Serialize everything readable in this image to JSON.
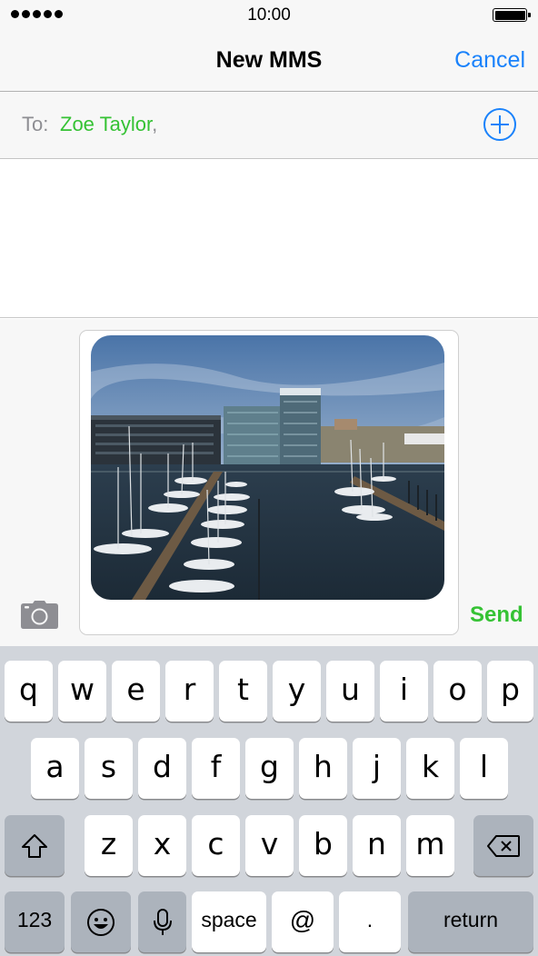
{
  "status_bar": {
    "time": "10:00",
    "signal_dots": 5,
    "battery_level": 1.0
  },
  "nav": {
    "title": "New MMS",
    "cancel_label": "Cancel"
  },
  "to_field": {
    "label": "To:",
    "recipient": "Zoe Taylor",
    "separator": ",",
    "add_icon": "plus-circle-icon"
  },
  "compose": {
    "attachment": "photo of a marina with sailboats and modern office buildings",
    "send_label": "Send",
    "camera_icon": "camera-icon"
  },
  "keyboard": {
    "row1": [
      "q",
      "w",
      "e",
      "r",
      "t",
      "y",
      "u",
      "i",
      "o",
      "p"
    ],
    "row2": [
      "a",
      "s",
      "d",
      "f",
      "g",
      "h",
      "j",
      "k",
      "l"
    ],
    "row3": [
      "z",
      "x",
      "c",
      "v",
      "b",
      "n",
      "m"
    ],
    "numbers_label": "123",
    "space_label": "space",
    "at_label": "@",
    "dot_label": ".",
    "return_label": "return",
    "shift_icon": "shift-arrow-icon",
    "delete_icon": "backspace-icon",
    "emoji_icon": "emoji-icon",
    "mic_icon": "microphone-icon"
  },
  "colors": {
    "accent_blue": "#1a82fb",
    "green": "#35c234",
    "keyboard_bg": "#d1d5db"
  }
}
